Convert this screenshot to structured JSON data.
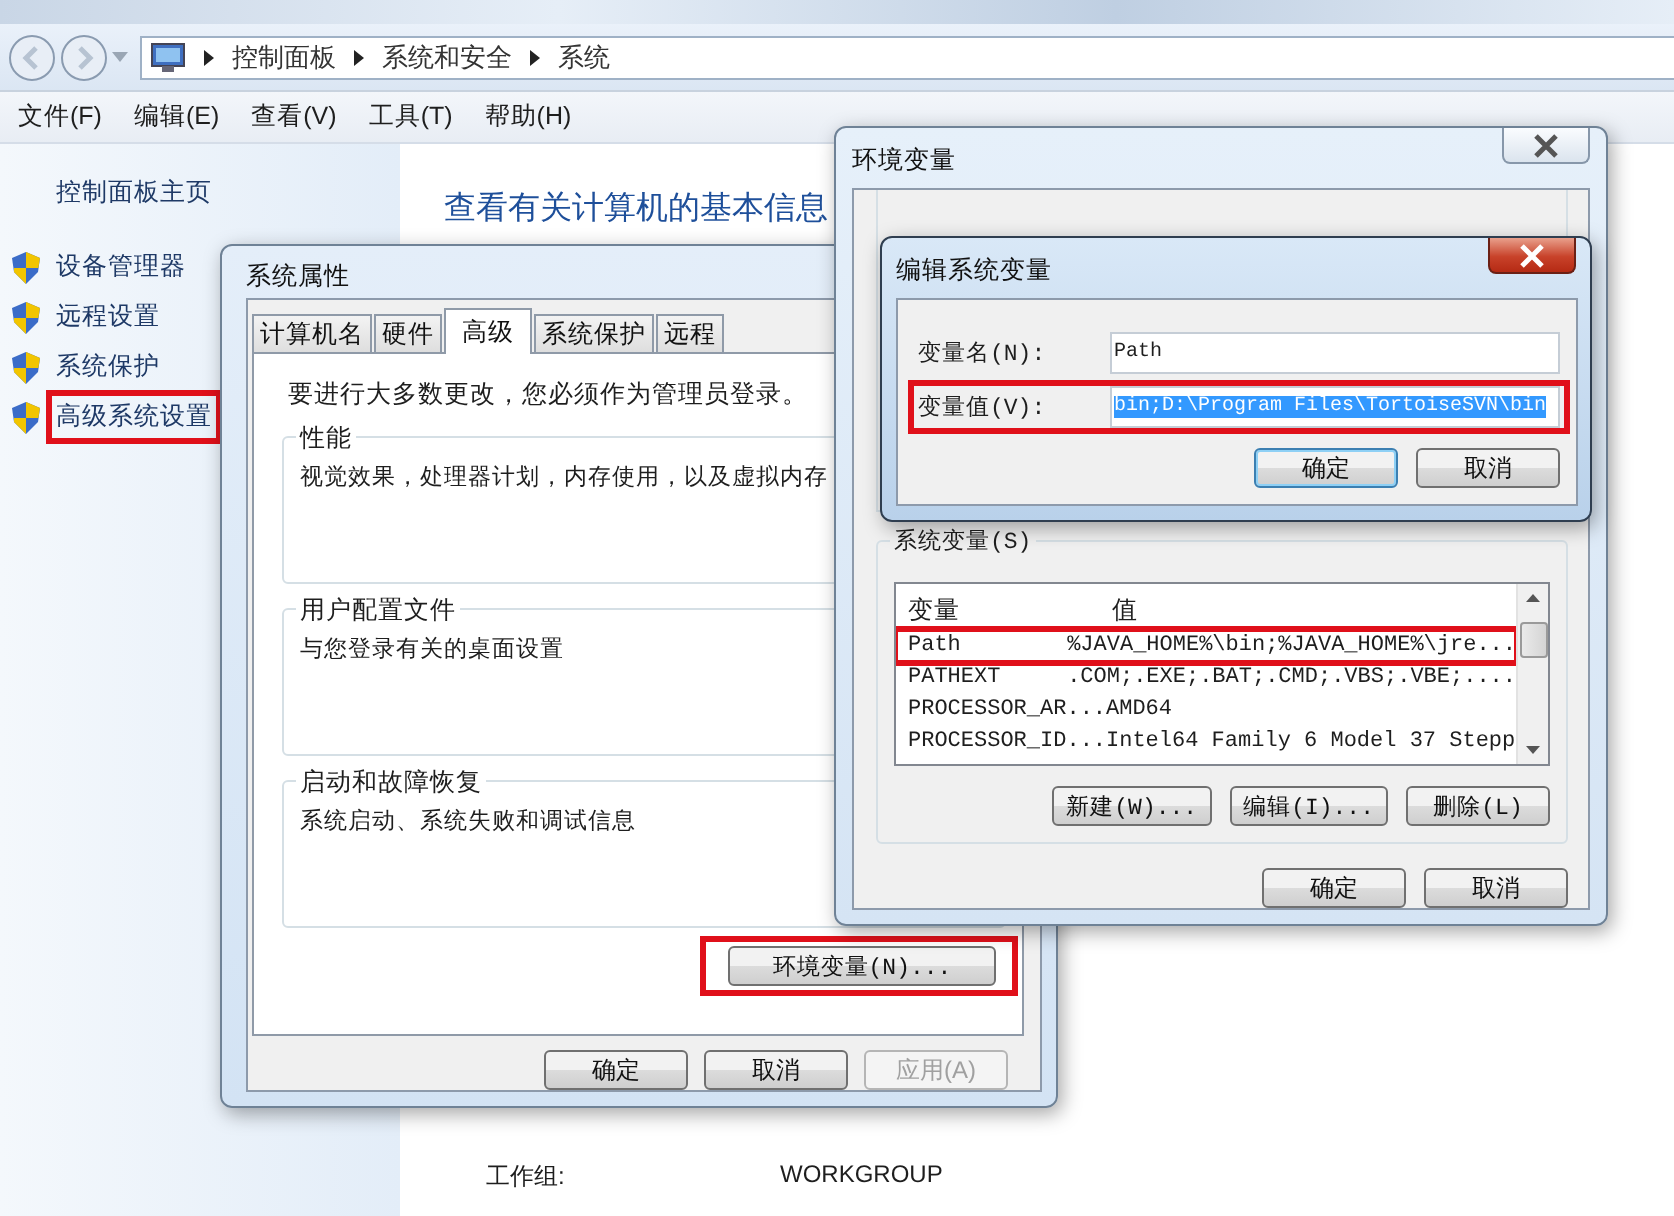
{
  "explorer": {
    "breadcrumb": [
      "控制面板",
      "系统和安全",
      "系统"
    ],
    "menu": [
      "文件(F)",
      "编辑(E)",
      "查看(V)",
      "工具(T)",
      "帮助(H)"
    ],
    "sidebar": {
      "home": "控制面板主页",
      "items": [
        {
          "label": "设备管理器",
          "highlighted": false
        },
        {
          "label": "远程设置",
          "highlighted": false
        },
        {
          "label": "系统保护",
          "highlighted": false
        },
        {
          "label": "高级系统设置",
          "highlighted": true
        }
      ]
    },
    "heading": "查看有关计算机的基本信息",
    "details": [
      {
        "label": "工作组:",
        "value": "WORKGROUP"
      }
    ]
  },
  "system_properties": {
    "title": "系统属性",
    "tabs": [
      {
        "label": "计算机名",
        "selected": false
      },
      {
        "label": "硬件",
        "selected": false
      },
      {
        "label": "高级",
        "selected": true
      },
      {
        "label": "系统保护",
        "selected": false
      },
      {
        "label": "远程",
        "selected": false
      }
    ],
    "notice": "要进行大多数更改，您必须作为管理员登录。",
    "groups": [
      {
        "title": "性能",
        "description": "视觉效果，处理器计划，内存使用，以及虚拟内存"
      },
      {
        "title": "用户配置文件",
        "description": "与您登录有关的桌面设置"
      },
      {
        "title": "启动和故障恢复",
        "description": "系统启动、系统失败和调试信息"
      }
    ],
    "env_button": {
      "label": "环境变量(N)...",
      "highlighted": true
    },
    "buttons": [
      {
        "label": "确定",
        "disabled": false
      },
      {
        "label": "取消",
        "disabled": false
      },
      {
        "label": "应用(A)",
        "disabled": true
      }
    ]
  },
  "environment_variables": {
    "title": "环境变量",
    "system_vars": {
      "title": "系统变量(S)",
      "columns": [
        "变量",
        "值"
      ],
      "rows": [
        {
          "name": "Path",
          "value": "%JAVA_HOME%\\bin;%JAVA_HOME%\\jre...",
          "highlighted": true
        },
        {
          "name": "PATHEXT",
          "value": ".COM;.EXE;.BAT;.CMD;.VBS;.VBE;....",
          "highlighted": false
        },
        {
          "name": "PROCESSOR_AR...",
          "value": "AMD64",
          "highlighted": false
        },
        {
          "name": "PROCESSOR_ID...",
          "value": "Intel64 Family 6 Model 37 Stepp",
          "highlighted": false
        }
      ]
    },
    "actions": [
      "新建(W)...",
      "编辑(I)...",
      "删除(L)"
    ],
    "buttons": [
      "确定",
      "取消"
    ]
  },
  "edit_variable": {
    "title": "编辑系统变量",
    "fields": [
      {
        "label": "变量名(N):",
        "value": "Path",
        "selected": false,
        "highlighted": false
      },
      {
        "label": "变量值(V):",
        "value": "bin;D:\\Program Files\\TortoiseSVN\\bin",
        "selected": true,
        "highlighted": true
      }
    ],
    "buttons": [
      {
        "label": "确定",
        "default": true
      },
      {
        "label": "取消",
        "default": false
      }
    ]
  }
}
